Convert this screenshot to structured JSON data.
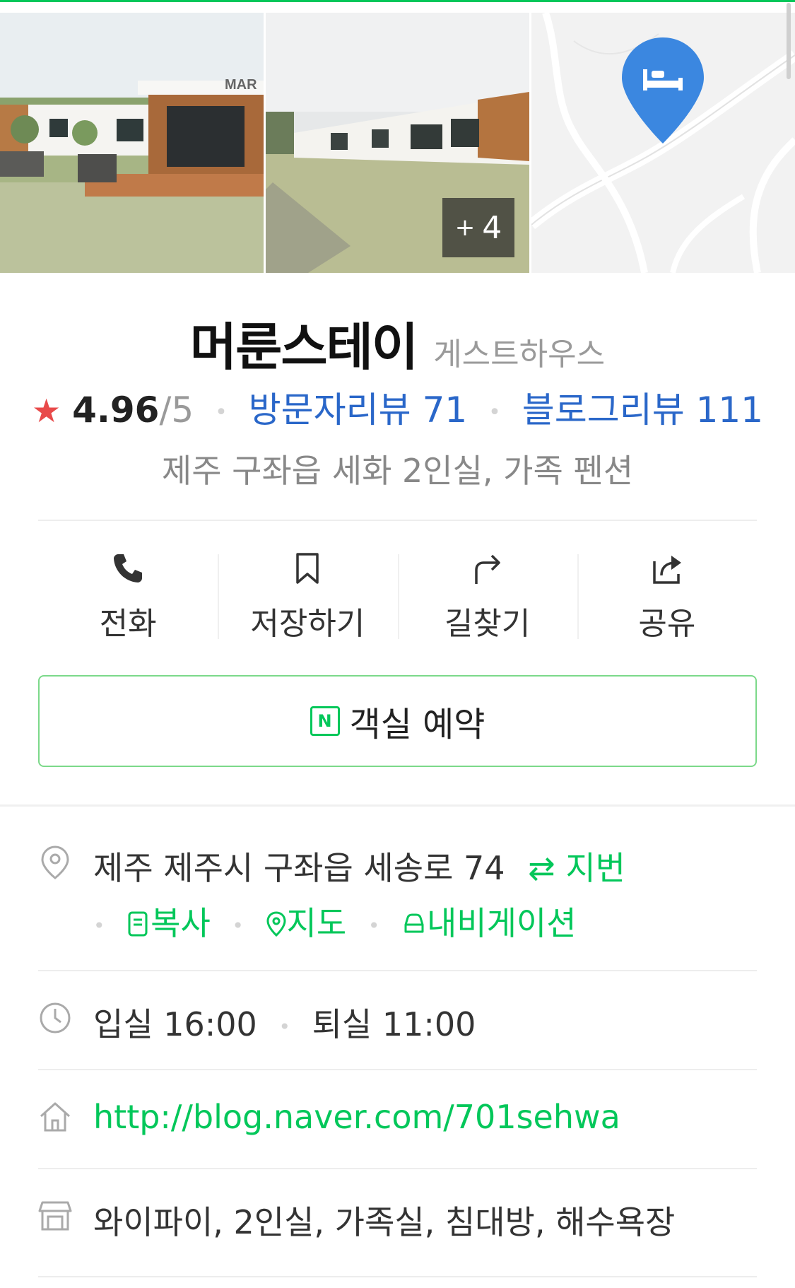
{
  "photos": {
    "more_count": "4",
    "more_plus": "+",
    "photo1_sign": "MAR"
  },
  "place": {
    "name": "머룬스테이",
    "category": "게스트하우스",
    "rating": "4.96",
    "rating_scale": "/5",
    "visitor_reviews": "방문자리뷰 71",
    "blog_reviews": "블로그리뷰 111",
    "description": "제주 구좌읍 세화 2인실, 가족 펜션"
  },
  "actions": [
    {
      "label": "전화",
      "icon": "phone-icon"
    },
    {
      "label": "저장하기",
      "icon": "bookmark-icon"
    },
    {
      "label": "길찾기",
      "icon": "directions-icon"
    },
    {
      "label": "공유",
      "icon": "share-icon"
    }
  ],
  "reserve": {
    "label": "객실 예약",
    "badge": "N"
  },
  "address": {
    "text": "제주 제주시 구좌읍 세송로 74",
    "toggle_label": "지번",
    "toggle_icon": "⇄",
    "copy_label": "복사",
    "map_label": "지도",
    "navi_label": "내비게이션"
  },
  "hours": {
    "checkin": "입실 16:00",
    "checkout": "퇴실 11:00"
  },
  "homepage": {
    "url": "http://blog.naver.com/701sehwa"
  },
  "amenities": {
    "text": "와이파이, 2인실, 가족실, 침대방, 해수욕장"
  },
  "colors": {
    "accent": "#03c75a",
    "link_blue": "#2a67c9",
    "star": "#e84a4a",
    "map_pin": "#3b87e0"
  }
}
